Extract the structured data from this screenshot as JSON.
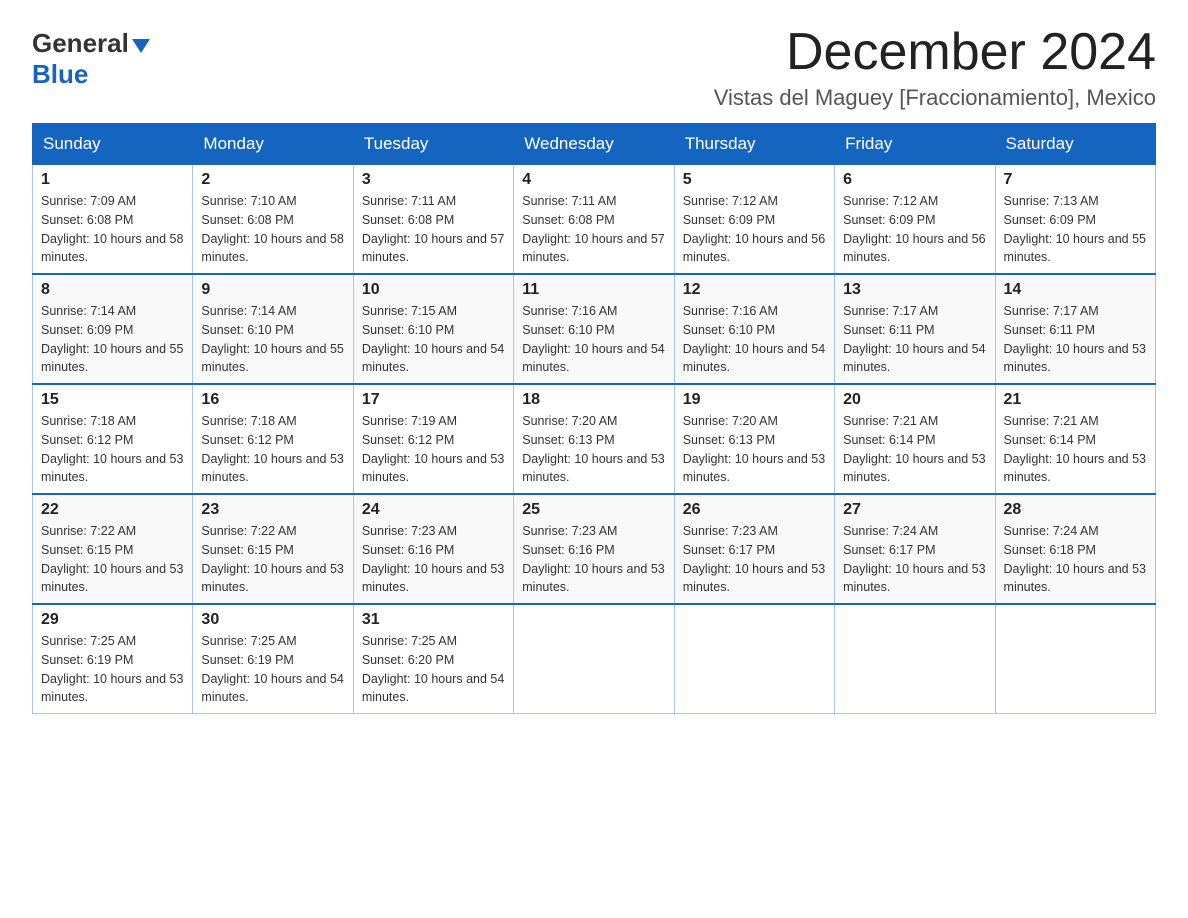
{
  "logo": {
    "general": "General",
    "blue": "Blue",
    "triangle": "▼"
  },
  "title": "December 2024",
  "subtitle": "Vistas del Maguey [Fraccionamiento], Mexico",
  "headers": [
    "Sunday",
    "Monday",
    "Tuesday",
    "Wednesday",
    "Thursday",
    "Friday",
    "Saturday"
  ],
  "weeks": [
    [
      {
        "day": "1",
        "sunrise": "7:09 AM",
        "sunset": "6:08 PM",
        "daylight": "10 hours and 58 minutes."
      },
      {
        "day": "2",
        "sunrise": "7:10 AM",
        "sunset": "6:08 PM",
        "daylight": "10 hours and 58 minutes."
      },
      {
        "day": "3",
        "sunrise": "7:11 AM",
        "sunset": "6:08 PM",
        "daylight": "10 hours and 57 minutes."
      },
      {
        "day": "4",
        "sunrise": "7:11 AM",
        "sunset": "6:08 PM",
        "daylight": "10 hours and 57 minutes."
      },
      {
        "day": "5",
        "sunrise": "7:12 AM",
        "sunset": "6:09 PM",
        "daylight": "10 hours and 56 minutes."
      },
      {
        "day": "6",
        "sunrise": "7:12 AM",
        "sunset": "6:09 PM",
        "daylight": "10 hours and 56 minutes."
      },
      {
        "day": "7",
        "sunrise": "7:13 AM",
        "sunset": "6:09 PM",
        "daylight": "10 hours and 55 minutes."
      }
    ],
    [
      {
        "day": "8",
        "sunrise": "7:14 AM",
        "sunset": "6:09 PM",
        "daylight": "10 hours and 55 minutes."
      },
      {
        "day": "9",
        "sunrise": "7:14 AM",
        "sunset": "6:10 PM",
        "daylight": "10 hours and 55 minutes."
      },
      {
        "day": "10",
        "sunrise": "7:15 AM",
        "sunset": "6:10 PM",
        "daylight": "10 hours and 54 minutes."
      },
      {
        "day": "11",
        "sunrise": "7:16 AM",
        "sunset": "6:10 PM",
        "daylight": "10 hours and 54 minutes."
      },
      {
        "day": "12",
        "sunrise": "7:16 AM",
        "sunset": "6:10 PM",
        "daylight": "10 hours and 54 minutes."
      },
      {
        "day": "13",
        "sunrise": "7:17 AM",
        "sunset": "6:11 PM",
        "daylight": "10 hours and 54 minutes."
      },
      {
        "day": "14",
        "sunrise": "7:17 AM",
        "sunset": "6:11 PM",
        "daylight": "10 hours and 53 minutes."
      }
    ],
    [
      {
        "day": "15",
        "sunrise": "7:18 AM",
        "sunset": "6:12 PM",
        "daylight": "10 hours and 53 minutes."
      },
      {
        "day": "16",
        "sunrise": "7:18 AM",
        "sunset": "6:12 PM",
        "daylight": "10 hours and 53 minutes."
      },
      {
        "day": "17",
        "sunrise": "7:19 AM",
        "sunset": "6:12 PM",
        "daylight": "10 hours and 53 minutes."
      },
      {
        "day": "18",
        "sunrise": "7:20 AM",
        "sunset": "6:13 PM",
        "daylight": "10 hours and 53 minutes."
      },
      {
        "day": "19",
        "sunrise": "7:20 AM",
        "sunset": "6:13 PM",
        "daylight": "10 hours and 53 minutes."
      },
      {
        "day": "20",
        "sunrise": "7:21 AM",
        "sunset": "6:14 PM",
        "daylight": "10 hours and 53 minutes."
      },
      {
        "day": "21",
        "sunrise": "7:21 AM",
        "sunset": "6:14 PM",
        "daylight": "10 hours and 53 minutes."
      }
    ],
    [
      {
        "day": "22",
        "sunrise": "7:22 AM",
        "sunset": "6:15 PM",
        "daylight": "10 hours and 53 minutes."
      },
      {
        "day": "23",
        "sunrise": "7:22 AM",
        "sunset": "6:15 PM",
        "daylight": "10 hours and 53 minutes."
      },
      {
        "day": "24",
        "sunrise": "7:23 AM",
        "sunset": "6:16 PM",
        "daylight": "10 hours and 53 minutes."
      },
      {
        "day": "25",
        "sunrise": "7:23 AM",
        "sunset": "6:16 PM",
        "daylight": "10 hours and 53 minutes."
      },
      {
        "day": "26",
        "sunrise": "7:23 AM",
        "sunset": "6:17 PM",
        "daylight": "10 hours and 53 minutes."
      },
      {
        "day": "27",
        "sunrise": "7:24 AM",
        "sunset": "6:17 PM",
        "daylight": "10 hours and 53 minutes."
      },
      {
        "day": "28",
        "sunrise": "7:24 AM",
        "sunset": "6:18 PM",
        "daylight": "10 hours and 53 minutes."
      }
    ],
    [
      {
        "day": "29",
        "sunrise": "7:25 AM",
        "sunset": "6:19 PM",
        "daylight": "10 hours and 53 minutes."
      },
      {
        "day": "30",
        "sunrise": "7:25 AM",
        "sunset": "6:19 PM",
        "daylight": "10 hours and 54 minutes."
      },
      {
        "day": "31",
        "sunrise": "7:25 AM",
        "sunset": "6:20 PM",
        "daylight": "10 hours and 54 minutes."
      },
      null,
      null,
      null,
      null
    ]
  ]
}
